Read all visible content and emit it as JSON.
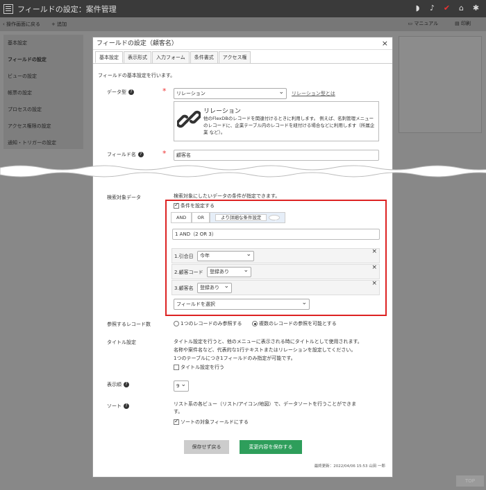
{
  "header": {
    "title": "フィールドの設定：案件管理"
  },
  "subbar": {
    "back": "操作画面に戻る",
    "add": "追加",
    "manual": "マニュアル",
    "print": "印刷"
  },
  "sidebar": {
    "items": [
      {
        "label": "基本設定"
      },
      {
        "label": "フィールドの設定"
      },
      {
        "label": "ビューの設定"
      },
      {
        "label": "帳票の設定"
      },
      {
        "label": "プロセスの設定"
      },
      {
        "label": "アクセス権限の設定"
      },
      {
        "label": "通知・トリガーの設定"
      }
    ]
  },
  "dialog": {
    "title": "フィールドの設定（顧客名）",
    "tabs": [
      {
        "label": "基本設定"
      },
      {
        "label": "表示形式"
      },
      {
        "label": "入力フォーム"
      },
      {
        "label": "条件書式"
      },
      {
        "label": "アクセス権"
      }
    ],
    "description": "フィールドの基本設定を行います。",
    "data_type": {
      "label": "データ型",
      "value": "リレーション",
      "link": "リレーション型とは"
    },
    "relation": {
      "title": "リレーション",
      "desc": "他のFlexDBのレコードを関連付けるときに利用します。 例えば、名刺管理メニューのレコードに、企業テーブル内のレコードを紐付ける場合などに利用します（所属企業 など）。"
    },
    "field_name": {
      "label": "フィールド名",
      "value": "顧客名"
    },
    "search": {
      "label": "検索対象データ",
      "desc": "検索対象にしたいデータの条件が指定できます。",
      "checkbox": "条件を設定する",
      "and": "AND",
      "or": "OR",
      "detail": "より詳細な条件設定",
      "expression": "1 AND（2 OR 3）",
      "conditions": [
        {
          "label": "1.引合日",
          "value": "今年"
        },
        {
          "label": "2.顧客コード",
          "value": "登録あり"
        },
        {
          "label": "3.顧客名",
          "value": "登録あり"
        }
      ],
      "field_select": "フィールドを選択"
    },
    "ref_count": {
      "label": "参照するレコード数",
      "opt1": "1つのレコードのみ参照する",
      "opt2": "複数のレコードの参照を可能とする"
    },
    "title_setting": {
      "label": "タイトル設定",
      "desc1": "タイトル設定を行うと、他のメニューに表示される時にタイトルとして使用されます。",
      "desc2": "名称や案件名など、代表的な1行テキストまたはリレーションを設定してください。",
      "desc3": "1つのテーブルにつき1フィールドのみ指定が可能です。",
      "checkbox": "タイトル設定を行う"
    },
    "display_order": {
      "label": "表示順",
      "value": "9"
    },
    "sort": {
      "label": "ソート",
      "desc1": "リスト系の各ビュー（リスト/アイコン/地図）で、データソートを行うことができま",
      "desc2": "す。",
      "checkbox": "ソートの対象フィールドにする"
    },
    "buttons": {
      "cancel": "保存せず戻る",
      "save": "変更内容を保存する"
    },
    "updated": "最終更新：2022/04/06 15:53 山田 一郎"
  },
  "top_button": "TOP",
  "colors": {
    "accent": "#2e9e5b",
    "highlight": "#dd2222"
  }
}
